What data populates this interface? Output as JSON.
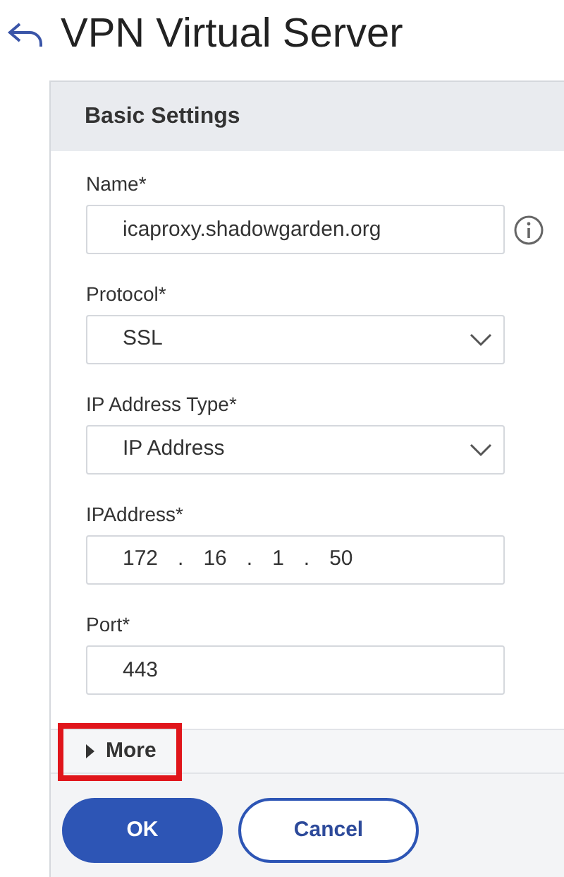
{
  "page": {
    "title": "VPN Virtual Server"
  },
  "section": {
    "title": "Basic Settings"
  },
  "fields": [
    {
      "kind": "text",
      "label": "Name*",
      "value": "icaproxy.shadowgarden.org",
      "info": true
    },
    {
      "kind": "select",
      "label": "Protocol*",
      "value": "SSL",
      "info": false
    },
    {
      "kind": "select",
      "label": "IP Address Type*",
      "value": "IP Address",
      "info": false
    },
    {
      "kind": "ip",
      "label": "IPAddress*",
      "octets": [
        "172",
        "16",
        "1",
        "50"
      ],
      "separator": ".",
      "info": false
    },
    {
      "kind": "text",
      "label": "Port*",
      "value": "443",
      "info": false
    }
  ],
  "more": {
    "label": "More",
    "expanded": false,
    "highlighted": true
  },
  "buttons": [
    {
      "label": "OK",
      "kind": "primary"
    },
    {
      "label": "Cancel",
      "kind": "secondary"
    }
  ]
}
